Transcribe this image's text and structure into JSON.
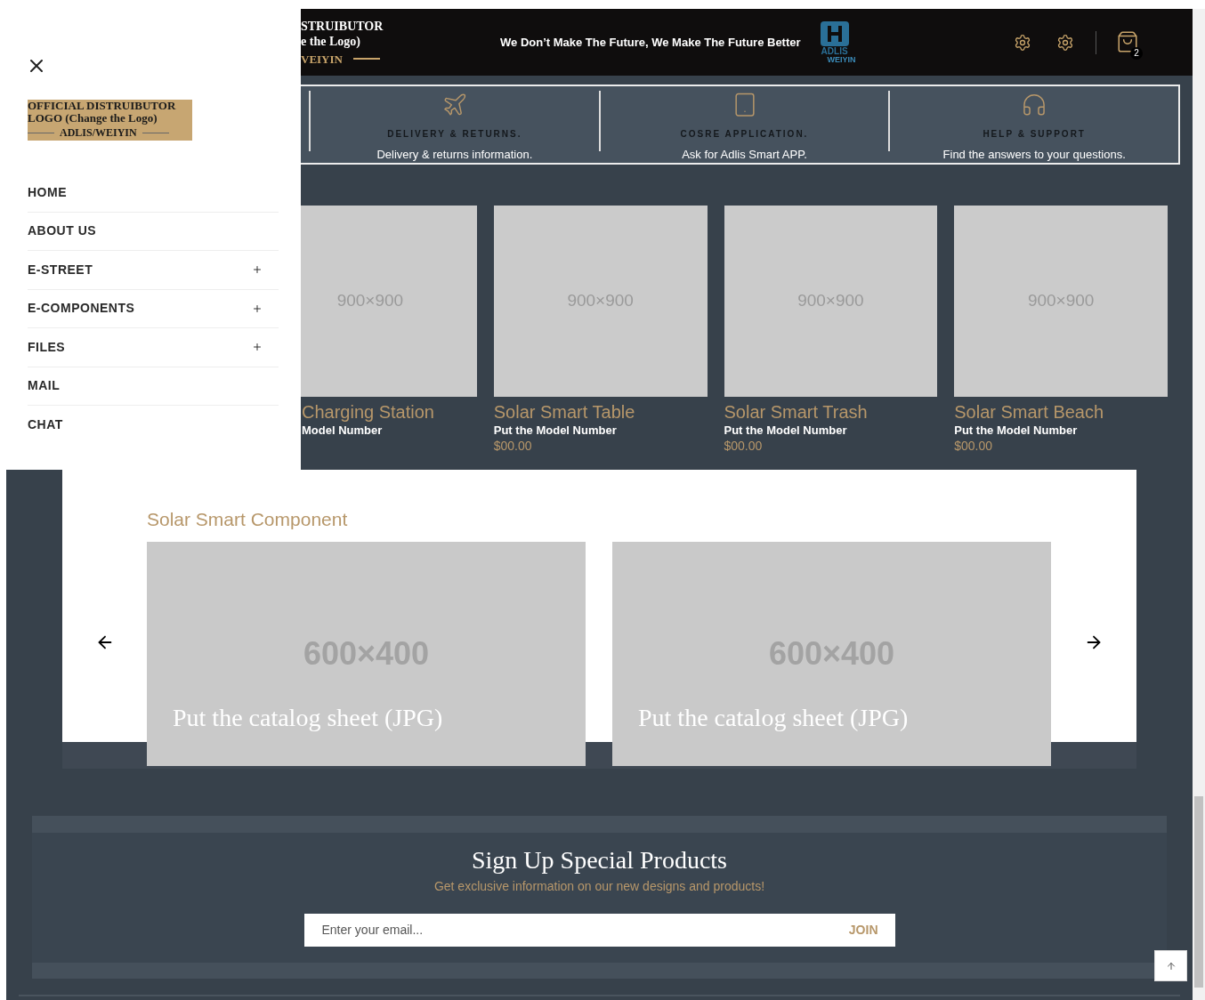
{
  "header": {
    "logo_lines": [
      "STRUIBUTOR",
      "e the Logo)",
      "VEIYIN"
    ],
    "tagline": "We Don’t Make The Future, We Make The Future Better",
    "brand": [
      "ADLIS",
      "WEIYIN"
    ],
    "cart_count": "2"
  },
  "features": [
    {
      "kind": "plane",
      "title": "DELIVERY & RETURNS.",
      "text": "Delivery & returns information."
    },
    {
      "kind": "tablet",
      "title": "COSRE APPLICATION.",
      "text": "Ask for Adlis Smart APP."
    },
    {
      "kind": "headset",
      "title": "HELP & SUPPORT",
      "text": "Find the answers to your questions."
    }
  ],
  "products": [
    {
      "image": "900×900",
      "title": "Charging Station",
      "subtitle": "Model Number"
    },
    {
      "image": "900×900",
      "title": "Solar Smart Table",
      "subtitle": "Put the Model Number",
      "price": "$00.00"
    },
    {
      "image": "900×900",
      "title": "Solar Smart Trash",
      "subtitle": "Put the Model Number",
      "price": "$00.00"
    },
    {
      "image": "900×900",
      "title": "Solar Smart Beach",
      "subtitle": "Put the Model Number",
      "price": "$00.00"
    }
  ],
  "component_section": {
    "title": "Solar Smart Component",
    "slides": [
      {
        "image": "600×400",
        "caption": "Put the catalog sheet (JPG)"
      },
      {
        "image": "600×400",
        "caption": "Put the catalog sheet (JPG)"
      }
    ]
  },
  "signup": {
    "title": "Sign Up Special Products",
    "subtitle": "Get exclusive information on our new designs and products!",
    "placeholder": "Enter your email...",
    "button": "JOIN"
  },
  "drawer": {
    "logo": [
      "OFFICIAL DISTRUIBUTOR",
      "LOGO (Change the Logo)",
      "ADLIS/WEIYIN"
    ],
    "menu": [
      {
        "label": "HOME",
        "expandable": false
      },
      {
        "label": "ABOUT US",
        "expandable": false
      },
      {
        "label": "E-STREET",
        "expandable": true
      },
      {
        "label": "E-COMPONENTS",
        "expandable": true
      },
      {
        "label": "FILES",
        "expandable": true
      },
      {
        "label": "MAIL",
        "expandable": false
      },
      {
        "label": "CHAT",
        "expandable": false
      }
    ]
  }
}
